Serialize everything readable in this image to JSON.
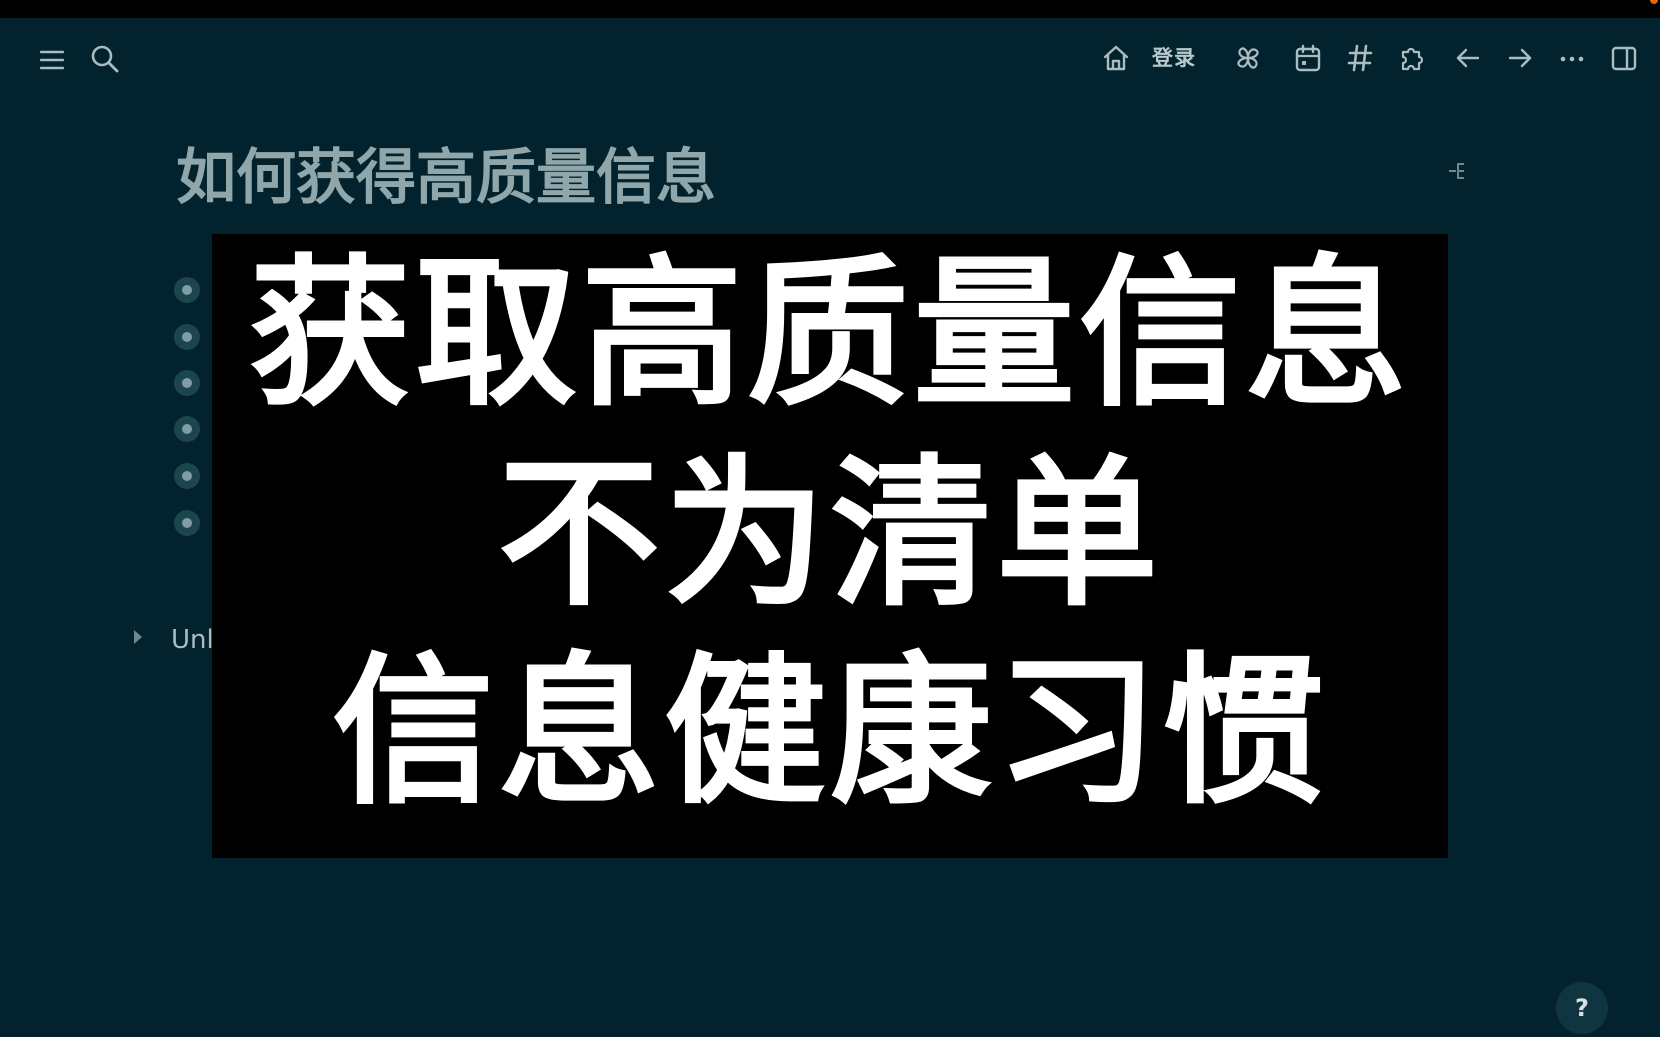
{
  "toolbar": {
    "left_icons": [
      "menu-icon",
      "search-icon"
    ],
    "login_label": "登录",
    "right_icons": [
      "home-icon",
      "pinwheel-icon",
      "calendar-icon",
      "hashtag-icon",
      "puzzle-icon",
      "arrow-left-icon",
      "arrow-right-icon",
      "more-icon",
      "sidebar-toggle-icon"
    ]
  },
  "page": {
    "title": "如何获得高质量信息",
    "outline_icon": "outline-icon",
    "bullet_count": 6
  },
  "linked_references": {
    "label": "Unl"
  },
  "overlay": {
    "line1": "获取高质量信息",
    "line2": "不为清单",
    "line3": "信息健康习惯"
  },
  "help_button": {
    "label": "?"
  },
  "colors": {
    "background": "#02232d",
    "overlay": "#000000",
    "icon": "#a9bcc0",
    "title": "#8fa6aa"
  }
}
